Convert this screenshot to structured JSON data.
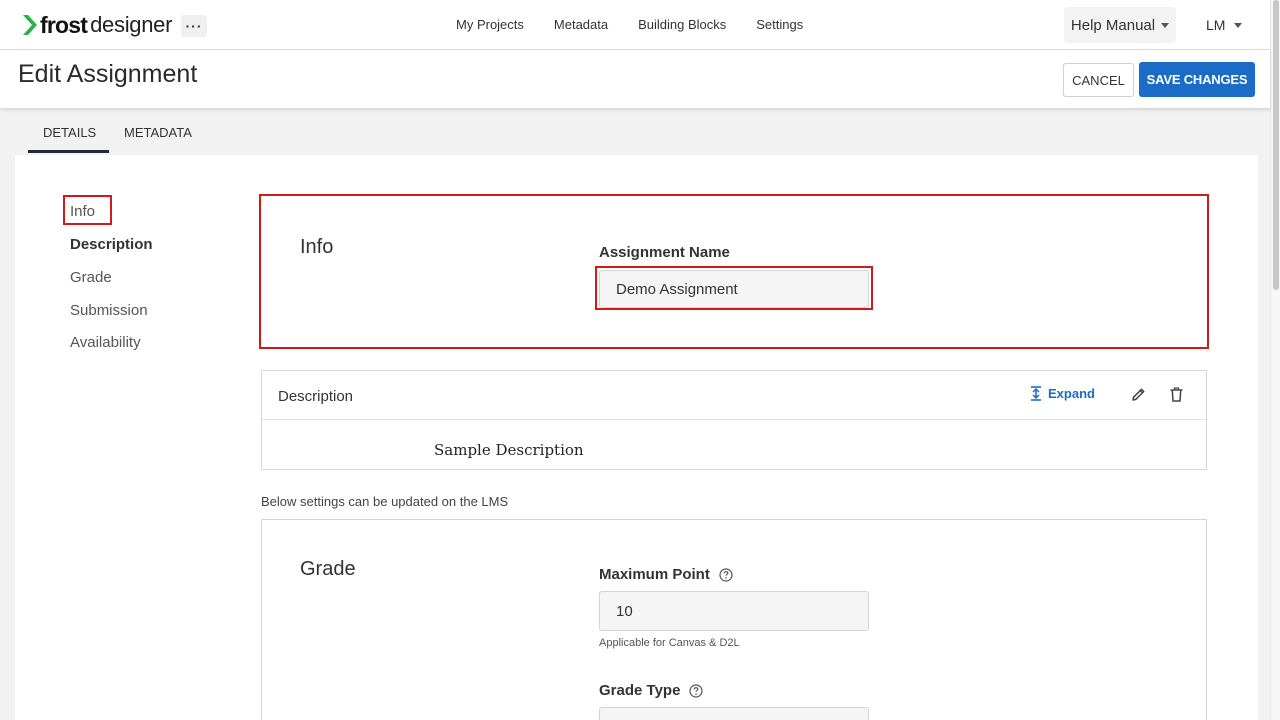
{
  "brand": {
    "frost": "frost",
    "designer": "designer",
    "more": "···"
  },
  "nav": {
    "links": [
      "My Projects",
      "Metadata",
      "Building Blocks",
      "Settings"
    ],
    "help": "Help Manual",
    "user": "LM"
  },
  "header": {
    "title": "Edit Assignment",
    "cancel": "CANCEL",
    "save": "SAVE CHANGES"
  },
  "tabs": [
    "DETAILS",
    "METADATA"
  ],
  "sidebar": {
    "items": [
      "Info",
      "Description",
      "Grade",
      "Submission",
      "Availability"
    ]
  },
  "info": {
    "heading": "Info",
    "name_label": "Assignment Name",
    "name_value": "Demo Assignment"
  },
  "description": {
    "title": "Description",
    "expand": "Expand",
    "body": "Sample Description"
  },
  "lms_note": "Below settings can be updated on the LMS",
  "grade": {
    "heading": "Grade",
    "max_label": "Maximum Point",
    "max_value": "10",
    "max_hint": "Applicable for Canvas & D2L",
    "type_label": "Grade Type"
  },
  "colors": {
    "accent": "#1a6cc7",
    "highlight": "#d11a1a",
    "logo_green": "#2bb24c"
  },
  "icons": [
    "frost-logo-icon",
    "more-icon",
    "caret-down-icon",
    "expand-icon",
    "edit-icon",
    "trash-icon",
    "help-circle-icon"
  ]
}
